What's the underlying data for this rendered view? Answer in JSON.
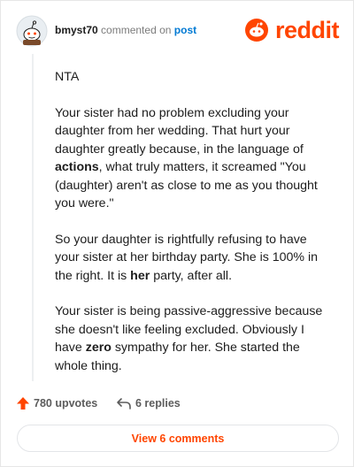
{
  "header": {
    "username": "bmyst70",
    "action": "commented on",
    "post_link": "post",
    "logo_text": "reddit"
  },
  "comment": {
    "p1": "NTA",
    "p2_a": "Your sister had no problem excluding your daughter from her wedding. That hurt your daughter greatly because, in the language of ",
    "p2_b": "actions",
    "p2_c": ", what truly matters, it screamed \"You (daughter) aren't as close to me as you thought you were.\"",
    "p3_a": "So your daughter is rightfully refusing to have your sister at her birthday party. She is 100% in the right. It is ",
    "p3_b": "her",
    "p3_c": " party, after all.",
    "p4_a": "Your sister is being passive-aggressive because she doesn't like feeling excluded. Obviously I have ",
    "p4_b": "zero",
    "p4_c": " sympathy for her. She started the whole thing."
  },
  "actions": {
    "upvotes": "780 upvotes",
    "replies": "6 replies",
    "view_comments": "View 6 comments"
  },
  "colors": {
    "brand": "#ff4500",
    "link": "#0079d3",
    "muted": "#7c7c7c"
  },
  "icons": {
    "avatar": "snoo-avatar-icon",
    "logo": "reddit-logo-icon",
    "upvote": "upvote-arrow-icon",
    "reply": "reply-arrow-icon"
  }
}
